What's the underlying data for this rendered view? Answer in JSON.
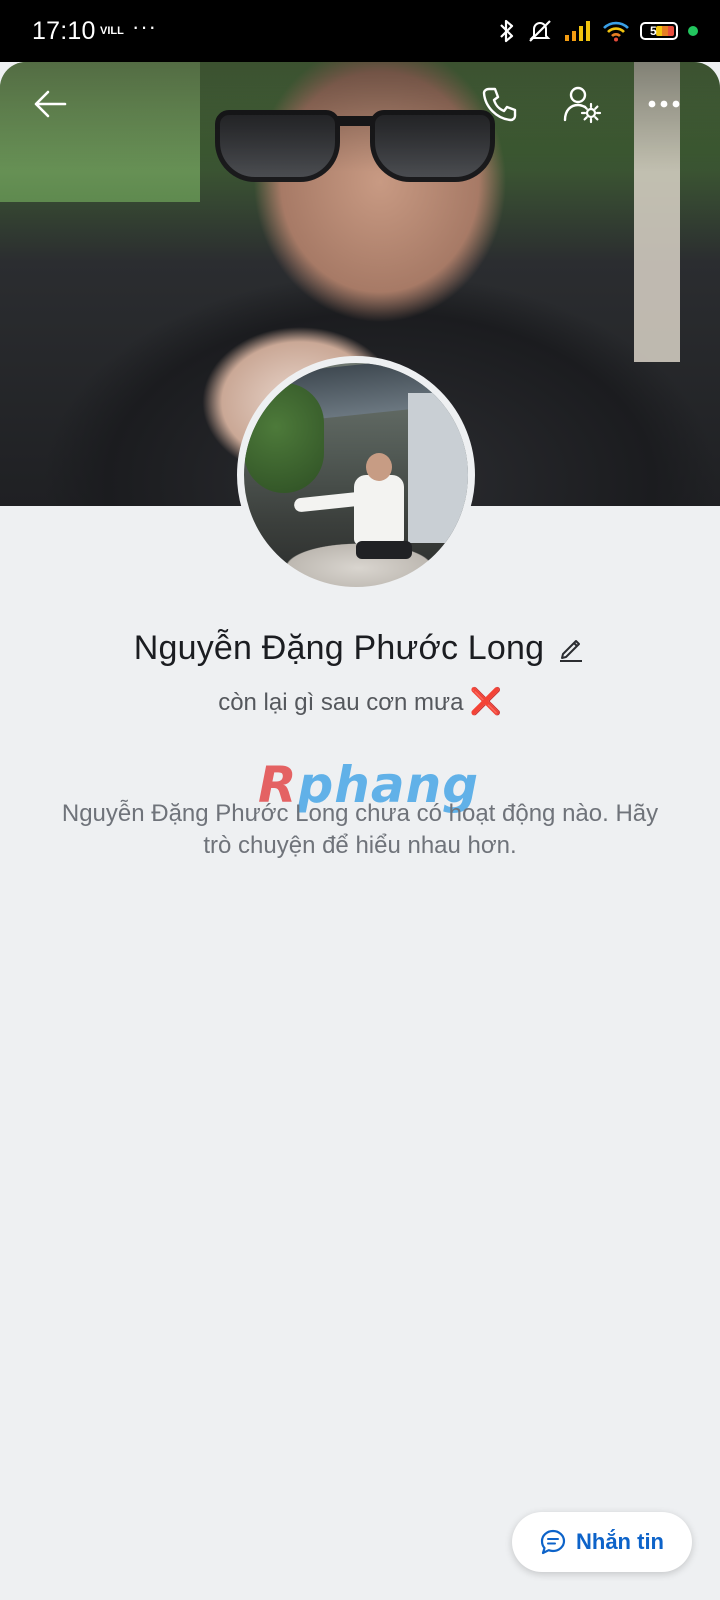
{
  "status_bar": {
    "time": "17:10",
    "carrier": "VILL",
    "overflow": "···",
    "battery": "5",
    "icons": [
      "bluetooth-icon",
      "mute-vibrate-icon",
      "signal-icon",
      "wifi-icon",
      "battery-icon",
      "active-dot"
    ]
  },
  "header": {
    "actions": [
      "back-arrow-icon",
      "phone-icon",
      "profile-settings-icon",
      "more-icon"
    ]
  },
  "profile": {
    "name": "Nguyễn Đặng Phước Long",
    "status": "còn lại gì sau cơn mưa",
    "status_emoji": "❌",
    "empty_message": "Nguyễn Đặng Phước Long chưa có hoạt động nào. Hãy trò chuyện để hiểu nhau hơn."
  },
  "watermark": {
    "part1": "R",
    "part2": "phang"
  },
  "message_button": {
    "label": "Nhắn tin"
  },
  "colors": {
    "accent": "#0d63c9",
    "background": "#eef0f2",
    "status_bar": "#000000"
  }
}
